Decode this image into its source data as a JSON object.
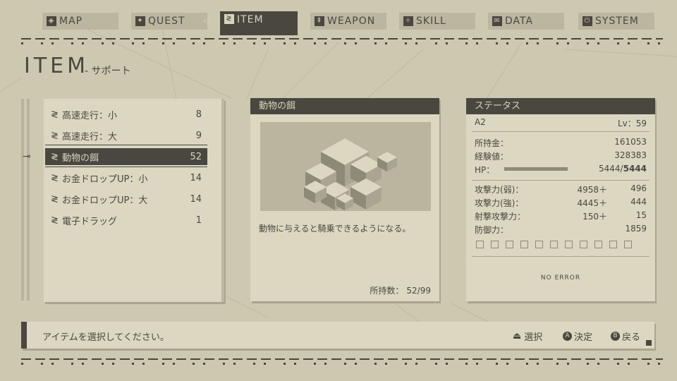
{
  "nav": {
    "tabs": [
      {
        "label": "MAP",
        "icon": "map-icon",
        "glyph": "◈"
      },
      {
        "label": "QUEST",
        "icon": "quest-icon",
        "glyph": "✦"
      },
      {
        "label": "ITEM",
        "icon": "item-icon",
        "glyph": "≷"
      },
      {
        "label": "WEAPON",
        "icon": "weapon-icon",
        "glyph": "⇞"
      },
      {
        "label": "SKILL",
        "icon": "skill-icon",
        "glyph": "✧"
      },
      {
        "label": "DATA",
        "icon": "data-icon",
        "glyph": "✉"
      },
      {
        "label": "SYSTEM",
        "icon": "system-icon",
        "glyph": "⏻"
      }
    ],
    "active_index": 2
  },
  "page": {
    "title": "ITEM",
    "subtitle": "- サポート"
  },
  "items": [
    {
      "name": "高速走行：小",
      "count": "8"
    },
    {
      "name": "高速走行：大",
      "count": "9"
    },
    {
      "name": "動物の餌",
      "count": "52"
    },
    {
      "name": "お金ドロップUP：小",
      "count": "14"
    },
    {
      "name": "お金ドロップUP：大",
      "count": "14"
    },
    {
      "name": "電子ドラッグ",
      "count": "1"
    }
  ],
  "selected_index": 2,
  "detail": {
    "title": "動物の餌",
    "description": "動物に与えると騎乗できるようになる。",
    "owned_label": "所持数：",
    "owned_value": "52/99"
  },
  "status": {
    "header": "ステータス",
    "character": "A2",
    "level": "Lv：59",
    "money_label": "所持金：",
    "money": "161053",
    "exp_label": "経験値：",
    "exp": "328383",
    "hp_label": "HP：",
    "hp_current": "5444/",
    "hp_max": "5444",
    "hp_fraction": 1.0,
    "atk_weak_label": "攻撃力(弱)：",
    "atk_weak": "4958＋",
    "atk_weak_bonus": "496",
    "atk_strong_label": "攻撃力(強)：",
    "atk_strong": "4445＋",
    "atk_strong_bonus": "444",
    "ranged_label": "射撃攻撃力：",
    "ranged": "150＋",
    "ranged_bonus": "15",
    "defense_label": "防御力：",
    "defense": "1859",
    "chip_count": 11,
    "error_text": "NO ERROR"
  },
  "footer": {
    "message": "アイテムを選択してください。",
    "select_label": "選択",
    "confirm_button": "A",
    "confirm_label": "決定",
    "back_button": "B",
    "back_label": "戻る"
  },
  "colors": {
    "background": "#cdc8b0",
    "panel": "#dcd7c1",
    "dark": "#4a4740",
    "light_text": "#dad4bd"
  }
}
